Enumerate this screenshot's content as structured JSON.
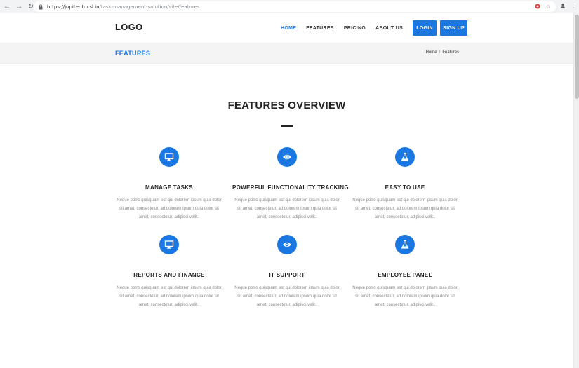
{
  "browser": {
    "url_host": "https://jupiter.toxsl.in",
    "url_path": "/task-management-solution/site/features"
  },
  "header": {
    "logo": "LOGO",
    "nav": [
      "HOME",
      "FEATURES",
      "PRICING",
      "ABOUT US"
    ],
    "active_nav": "HOME",
    "login_label": "LOGIN",
    "signup_label": "SIGN UP"
  },
  "title_band": {
    "title": "FEATURES",
    "breadcrumb": [
      "Home",
      "/",
      "Features"
    ]
  },
  "section": {
    "heading": "FEATURES OVERVIEW"
  },
  "features": [
    {
      "icon": "monitor-icon",
      "title": "MANAGE TASKS",
      "text": "Neque porro quisquam est qui dolorem ipsum quia dolor sit amet, consectetur, ad dolorem ipsum quia dolor sit amet, consectetur, adipisci velit.."
    },
    {
      "icon": "eye-icon",
      "title": "POWERFUL FUNCTIONALITY TRACKING",
      "text": "Neque porro quisquam est qui dolorem ipsum quia dolor sit amet, consectetur, ad dolorem ipsum quia dolor sit amet, consectetur, adipisci velit.."
    },
    {
      "icon": "flask-icon",
      "title": "EASY TO USE",
      "text": "Neque porro quisquam est qui dolorem ipsum quia dolor sit amet, consectetur, ad dolorem ipsum quia dolor sit amet, consectetur, adipisci velit.."
    },
    {
      "icon": "monitor-icon",
      "title": "REPORTS AND FINANCE",
      "text": "Neque porro quisquam est qui dolorem ipsum quia dolor sit amet, consectetur, ad dolorem ipsum quia dolor sit amet, consectetur, adipisci velit.."
    },
    {
      "icon": "eye-icon",
      "title": "IT SUPPORT",
      "text": "Neque porro quisquam est qui dolorem ipsum quia dolor sit amet, consectetur, ad dolorem ipsum quia dolor sit amet, consectetur, adipisci velit.."
    },
    {
      "icon": "flask-icon",
      "title": "EMPLOYEE PANEL",
      "text": "Neque porro quisquam est qui dolorem ipsum quia dolor sit amet, consectetur, ad dolorem ipsum quia dolor sit amet, consectetur, adipisci velit.."
    }
  ],
  "colors": {
    "accent": "#1b78e2",
    "band_bg": "#f4f4f4",
    "body_text": "#8a8a8a"
  }
}
